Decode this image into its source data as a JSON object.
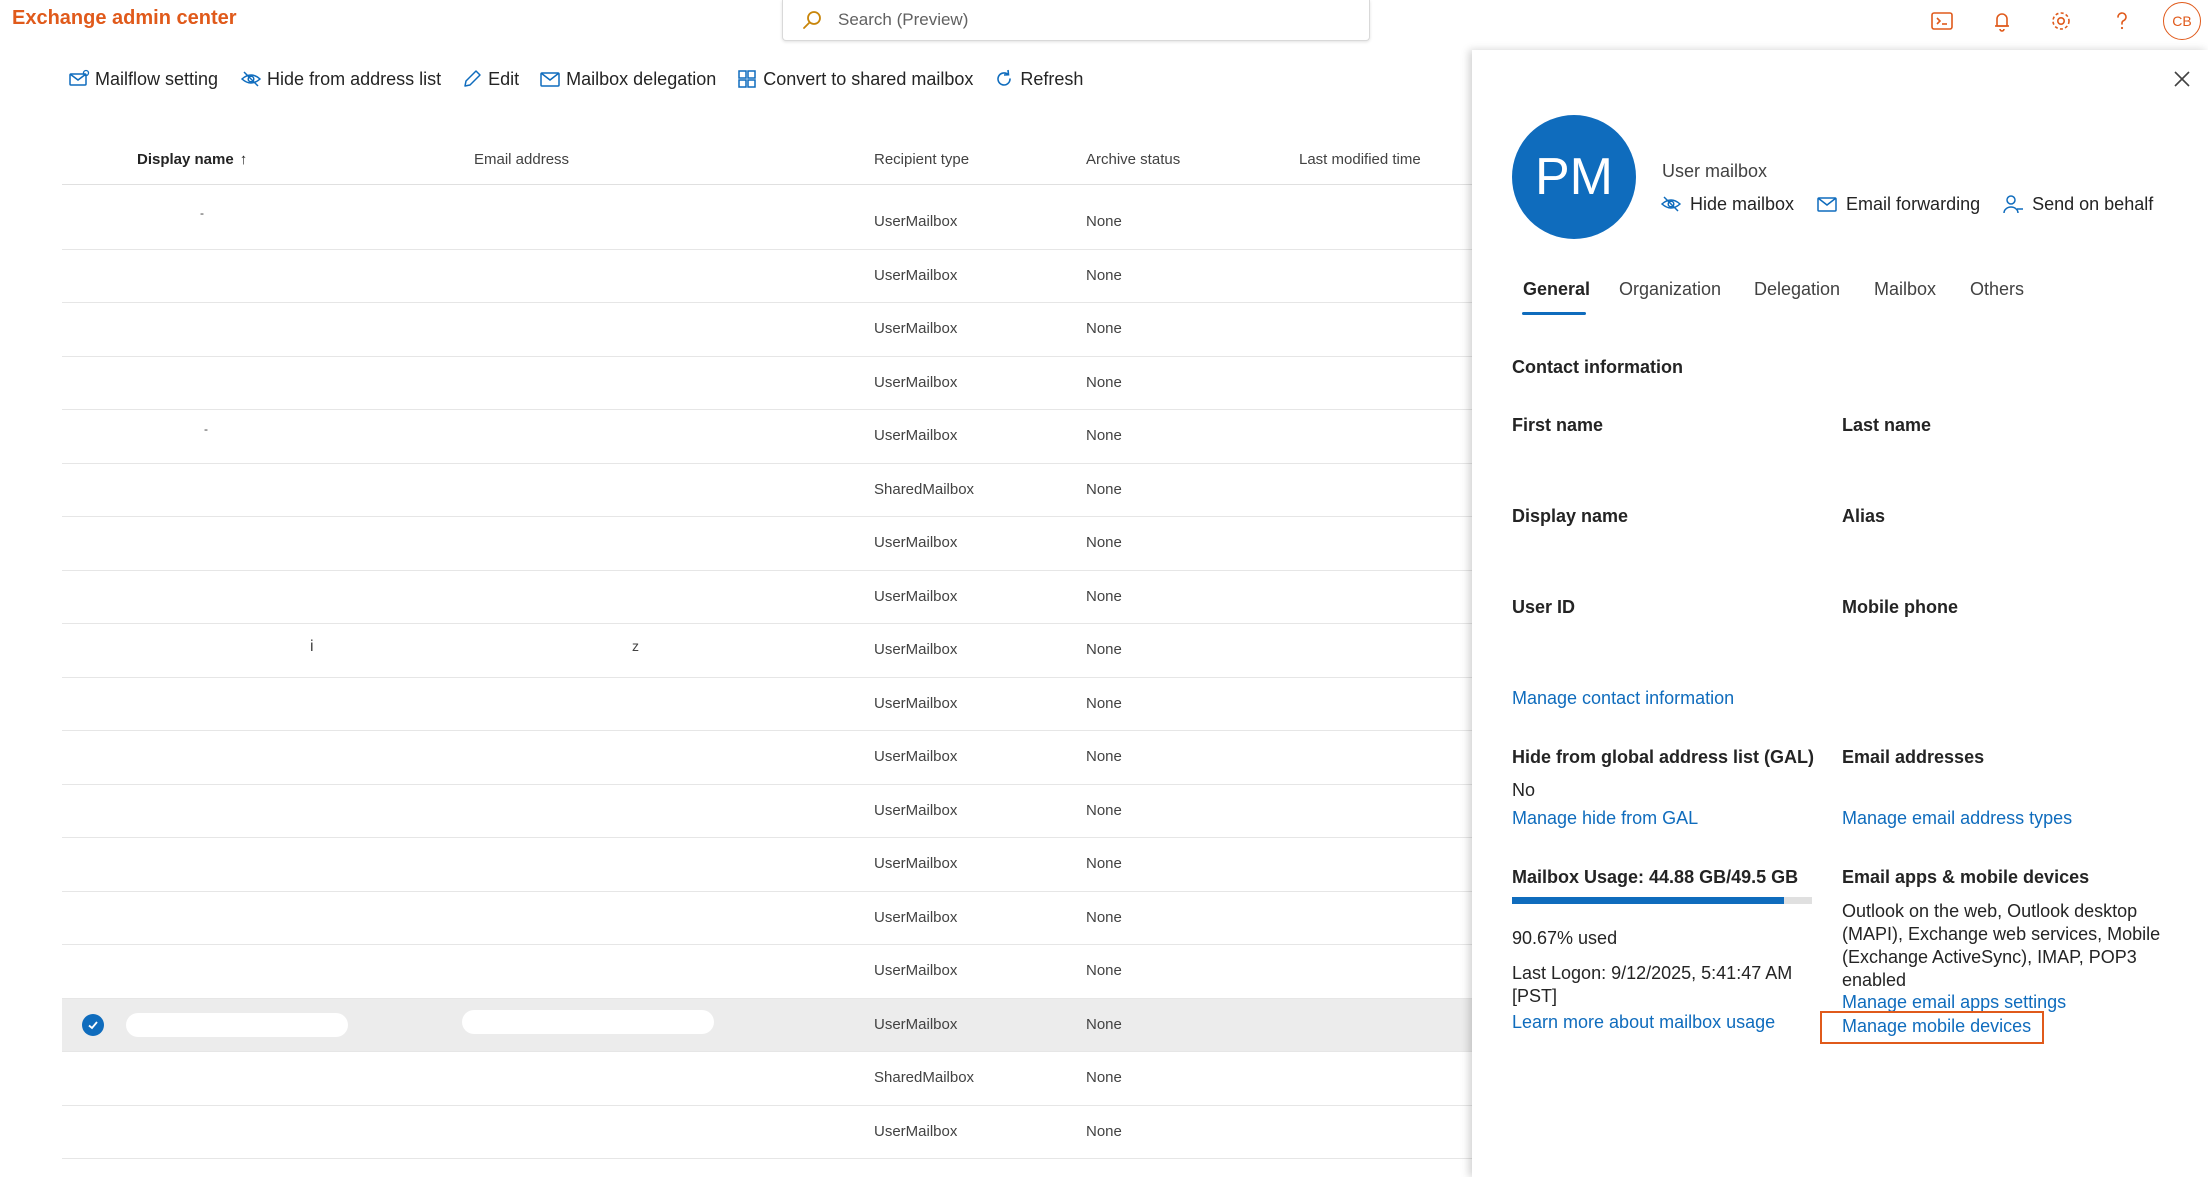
{
  "app": {
    "title": "Exchange admin center",
    "user_initials": "CB"
  },
  "search": {
    "placeholder": "Search (Preview)"
  },
  "toolbar": {
    "mailflow": "Mailflow setting",
    "hide": "Hide from address list",
    "edit": "Edit",
    "delegation": "Mailbox delegation",
    "convert": "Convert to shared mailbox",
    "refresh": "Refresh"
  },
  "table": {
    "columns": {
      "display_name": "Display name",
      "email": "Email address",
      "recipient_type": "Recipient type",
      "archive_status": "Archive status",
      "last_modified": "Last modified time"
    },
    "rows": [
      {
        "type": "UserMailbox",
        "archive": "None"
      },
      {
        "type": "UserMailbox",
        "archive": "None"
      },
      {
        "type": "UserMailbox",
        "archive": "None"
      },
      {
        "type": "UserMailbox",
        "archive": "None"
      },
      {
        "type": "UserMailbox",
        "archive": "None"
      },
      {
        "type": "SharedMailbox",
        "archive": "None"
      },
      {
        "type": "UserMailbox",
        "archive": "None"
      },
      {
        "type": "UserMailbox",
        "archive": "None"
      },
      {
        "type": "UserMailbox",
        "archive": "None"
      },
      {
        "type": "UserMailbox",
        "archive": "None"
      },
      {
        "type": "UserMailbox",
        "archive": "None"
      },
      {
        "type": "UserMailbox",
        "archive": "None"
      },
      {
        "type": "UserMailbox",
        "archive": "None"
      },
      {
        "type": "UserMailbox",
        "archive": "None"
      },
      {
        "type": "UserMailbox",
        "archive": "None"
      },
      {
        "type": "UserMailbox",
        "archive": "None"
      },
      {
        "type": "SharedMailbox",
        "archive": "None"
      },
      {
        "type": "UserMailbox",
        "archive": "None"
      }
    ]
  },
  "panel": {
    "initials": "PM",
    "mailbox_type": "User mailbox",
    "actions": {
      "hide": "Hide mailbox",
      "forwarding": "Email forwarding",
      "send_on_behalf": "Send on behalf"
    },
    "tabs": [
      "General",
      "Organization",
      "Delegation",
      "Mailbox",
      "Others"
    ],
    "contact": {
      "heading": "Contact information",
      "first_name": "First name",
      "last_name": "Last name",
      "display_name": "Display name",
      "alias": "Alias",
      "user_id": "User ID",
      "mobile_phone": "Mobile phone",
      "manage_link": "Manage contact information"
    },
    "gal": {
      "label": "Hide from global address list (GAL)",
      "value": "No",
      "link": "Manage hide from GAL"
    },
    "email_addresses": {
      "label": "Email addresses",
      "link": "Manage email address types"
    },
    "usage": {
      "label": "Mailbox Usage: 44.88 GB/49.5 GB",
      "percent_used": 90.67,
      "used_text": "90.67% used",
      "last_logon": "Last Logon: 9/12/2025, 5:41:47 AM [PST]",
      "link": "Learn more about mailbox usage"
    },
    "apps": {
      "label": "Email apps & mobile devices",
      "text": "Outlook on the web, Outlook desktop (MAPI), Exchange web services, Mobile (Exchange ActiveSync), IMAP, POP3 enabled",
      "settings_link": "Manage email apps settings",
      "devices_link": "Manage mobile devices"
    }
  },
  "colors": {
    "accent": "#0f6cbd",
    "brand": "#e05a1b"
  }
}
